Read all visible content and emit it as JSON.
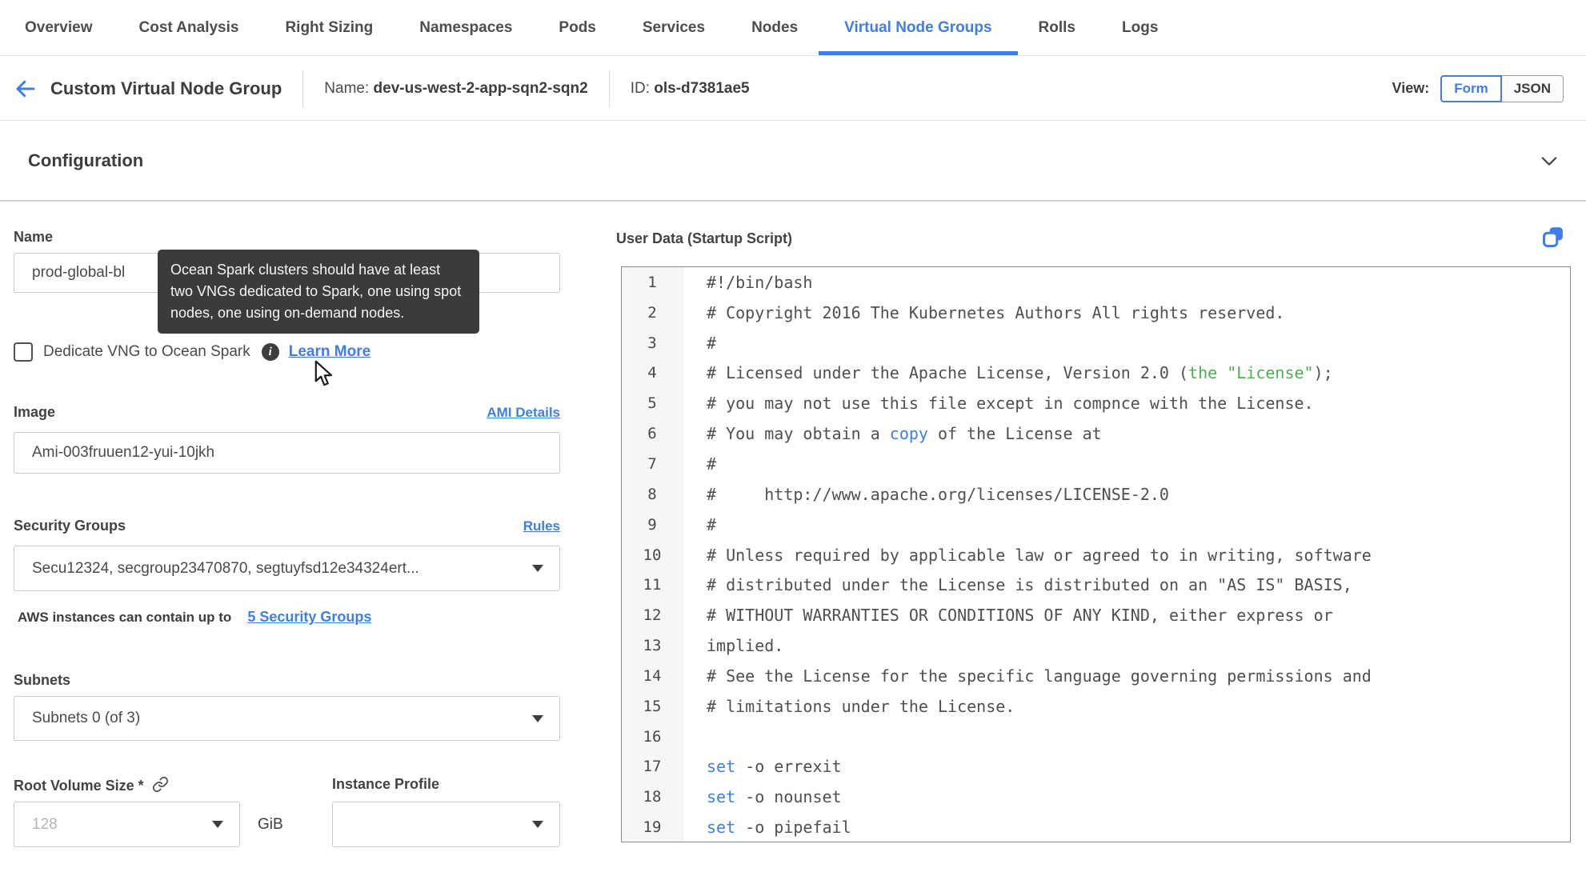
{
  "nav": {
    "tabs": [
      {
        "label": "Overview",
        "active": false
      },
      {
        "label": "Cost Analysis",
        "active": false
      },
      {
        "label": "Right Sizing",
        "active": false
      },
      {
        "label": "Namespaces",
        "active": false
      },
      {
        "label": "Pods",
        "active": false
      },
      {
        "label": "Services",
        "active": false
      },
      {
        "label": "Nodes",
        "active": false
      },
      {
        "label": "Virtual Node Groups",
        "active": true
      },
      {
        "label": "Rolls",
        "active": false
      },
      {
        "label": "Logs",
        "active": false
      }
    ]
  },
  "header": {
    "title": "Custom Virtual Node Group",
    "name_label": "Name:",
    "name_value": "dev-us-west-2-app-sqn2-sqn2",
    "id_label": "ID:",
    "id_value": "ols-d7381ae5",
    "view_label": "View:",
    "view_form": "Form",
    "view_json": "JSON"
  },
  "section": {
    "title": "Configuration"
  },
  "form": {
    "name": {
      "label": "Name",
      "value": "prod-global-bl"
    },
    "tooltip": "Ocean Spark clusters should have at least two VNGs dedicated to Spark, one using spot nodes, one using on-demand nodes.",
    "dedicate": {
      "label": "Dedicate VNG to Ocean Spark",
      "checked": false,
      "link": "Learn More"
    },
    "image": {
      "label": "Image",
      "link": "AMI Details",
      "value": "Ami-003fruuen12-yui-10jkh"
    },
    "security_groups": {
      "label": "Security Groups",
      "link": "Rules",
      "value": "Secu12324, secgroup23470870, segtuyfsd12e34324ert...",
      "note": "AWS instances can contain up to",
      "note_link": "5 Security Groups"
    },
    "subnets": {
      "label": "Subnets",
      "value": "Subnets 0 (of 3)"
    },
    "root_volume": {
      "label": "Root Volume Size *",
      "placeholder": "128",
      "unit": "GiB"
    },
    "instance_profile": {
      "label": "Instance Profile",
      "value": ""
    }
  },
  "user_data": {
    "label": "User Data (Startup Script)",
    "colors": {
      "d": "#4f4f4f",
      "g": "#4CAF50",
      "b": "#3E7EE8"
    },
    "lines": [
      {
        "n": 1,
        "seg": [
          {
            "t": "#!/bin/bash",
            "c": "d"
          }
        ]
      },
      {
        "n": 2,
        "seg": [
          {
            "t": "# Copyright 2016 The Kubernetes Authors All rights reserved.",
            "c": "d"
          }
        ]
      },
      {
        "n": 3,
        "seg": [
          {
            "t": "#",
            "c": "d"
          }
        ]
      },
      {
        "n": 4,
        "seg": [
          {
            "t": "# Licensed under the Apache License, Version 2.0 (",
            "c": "d"
          },
          {
            "t": "the \"License\"",
            "c": "g"
          },
          {
            "t": ");",
            "c": "d"
          }
        ]
      },
      {
        "n": 5,
        "seg": [
          {
            "t": "# you may not use this file except in compnce with the License.",
            "c": "d"
          }
        ]
      },
      {
        "n": 6,
        "seg": [
          {
            "t": "# You may obtain a ",
            "c": "d"
          },
          {
            "t": "copy",
            "c": "b"
          },
          {
            "t": " of the License at",
            "c": "d"
          }
        ]
      },
      {
        "n": 7,
        "seg": [
          {
            "t": "#",
            "c": "d"
          }
        ]
      },
      {
        "n": 8,
        "seg": [
          {
            "t": "#     http://www.apache.org/licenses/LICENSE-2.0",
            "c": "d"
          }
        ]
      },
      {
        "n": 9,
        "seg": [
          {
            "t": "#",
            "c": "d"
          }
        ]
      },
      {
        "n": 10,
        "seg": [
          {
            "t": "# Unless required by applicable law or agreed to in writing, software",
            "c": "d"
          }
        ]
      },
      {
        "n": 11,
        "seg": [
          {
            "t": "# distributed under the License is distributed on an \"AS IS\" BASIS,",
            "c": "d"
          }
        ]
      },
      {
        "n": 12,
        "seg": [
          {
            "t": "# WITHOUT WARRANTIES OR CONDITIONS OF ANY KIND, either express or",
            "c": "d"
          }
        ]
      },
      {
        "n": 13,
        "seg": [
          {
            "t": "implied.",
            "c": "d"
          }
        ]
      },
      {
        "n": 14,
        "seg": [
          {
            "t": "# See the License for the specific language governing permissions and",
            "c": "d"
          }
        ]
      },
      {
        "n": 15,
        "seg": [
          {
            "t": "# limitations under the License.",
            "c": "d"
          }
        ]
      },
      {
        "n": 16,
        "seg": [
          {
            "t": "",
            "c": "d"
          }
        ]
      },
      {
        "n": 17,
        "seg": [
          {
            "t": "set",
            "c": "b"
          },
          {
            "t": " -o errexit",
            "c": "d"
          }
        ]
      },
      {
        "n": 18,
        "seg": [
          {
            "t": "set",
            "c": "b"
          },
          {
            "t": " -o nounset",
            "c": "d"
          }
        ]
      },
      {
        "n": 19,
        "seg": [
          {
            "t": "set",
            "c": "b"
          },
          {
            "t": " -o pipefail",
            "c": "d"
          }
        ]
      }
    ]
  },
  "colors": {
    "accent_blue": "#3E7EE8",
    "tooltip_bg": "#3B3B3B",
    "syntax_green": "#4CAF50",
    "editor_gutter": "#F6F6F6"
  }
}
